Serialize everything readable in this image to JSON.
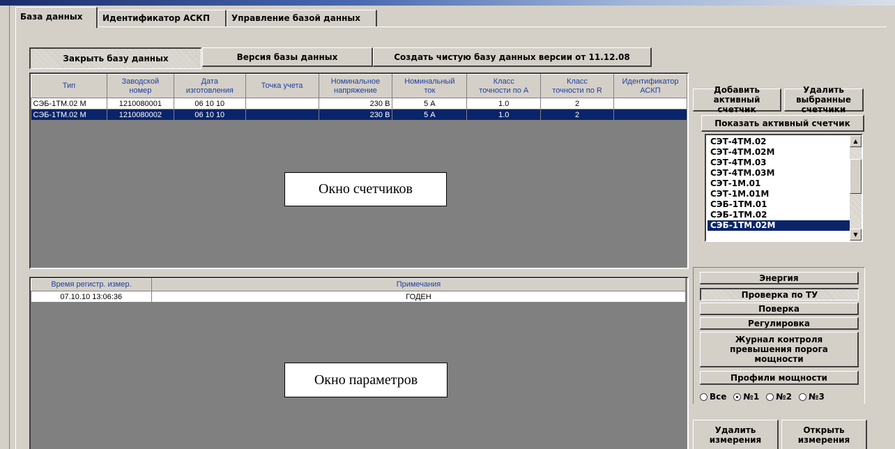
{
  "tabs": [
    {
      "label": "База данных"
    },
    {
      "label": "Идентификатор АСКП"
    },
    {
      "label": "Управление базой данных"
    }
  ],
  "toolbar": {
    "close_db": "Закрыть базу данных",
    "db_version": "Версия базы данных",
    "create_db": "Создать чистую базу данных версии от 11.12.08"
  },
  "meters_table": {
    "headers": [
      {
        "l1": "Тип",
        "l2": ""
      },
      {
        "l1": "Заводской",
        "l2": "номер"
      },
      {
        "l1": "Дата",
        "l2": "изготовления"
      },
      {
        "l1": "Точка учета",
        "l2": ""
      },
      {
        "l1": "Номинальное",
        "l2": "напряжение"
      },
      {
        "l1": "Номинальный",
        "l2": "ток"
      },
      {
        "l1": "Класс",
        "l2": "точности по A"
      },
      {
        "l1": "Класс",
        "l2": "точности по R"
      },
      {
        "l1": "Идентификатор",
        "l2": "АСКП"
      }
    ],
    "rows": [
      [
        "СЭБ-1ТМ.02 М",
        "1210080001",
        "06 10 10",
        "",
        "230 В",
        "5 А",
        "1.0",
        "2",
        ""
      ],
      [
        "СЭБ-1ТМ.02 М",
        "1210080002",
        "06 10 10",
        "",
        "230 В",
        "5 А",
        "1.0",
        "2",
        ""
      ]
    ]
  },
  "meters_caption": "Окно счетчиков",
  "params_table": {
    "headers": [
      "Время регистр. измер.",
      "Примечания"
    ],
    "rows": [
      [
        "07.10.10 13:06:36",
        "ГОДЕН"
      ]
    ]
  },
  "params_caption": "Окно параметров",
  "right_panel": {
    "add_active": [
      "Добавить",
      "активный",
      "счетчик"
    ],
    "delete_selected": [
      "Удалить",
      "выбранные",
      "счетчики"
    ],
    "show_active": "Показать активный счетчик",
    "meter_types": [
      "СЭТ-4ТМ.02",
      "СЭТ-4ТМ.02М",
      "СЭТ-4ТМ.03",
      "СЭТ-4ТМ.03М",
      "СЭТ-1М.01",
      "СЭТ-1М.01М",
      "СЭБ-1ТМ.01",
      "СЭБ-1ТМ.02",
      "СЭБ-1ТМ.02М"
    ],
    "selected_type_index": 8,
    "param_buttons": [
      "Энергия",
      "Проверка по ТУ",
      "Поверка",
      "Регулировка"
    ],
    "journal_button": [
      "Журнал контроля",
      "превышения порога",
      "мощности"
    ],
    "profiles_button": "Профили мощности",
    "profile_radios": [
      "Все",
      "№1",
      "№2",
      "№3"
    ],
    "profile_selected": "№1",
    "delete_measurements": [
      "Удалить",
      "измерения"
    ],
    "open_measurements": [
      "Открыть",
      "измерения"
    ]
  }
}
